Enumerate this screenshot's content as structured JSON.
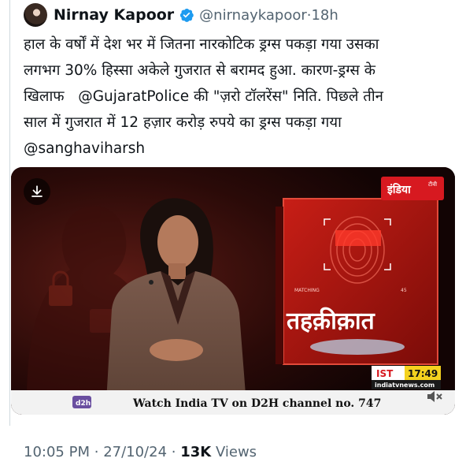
{
  "author": {
    "name": "Nirnay Kapoor",
    "handle": "@nirnaykapoor",
    "time": "18h",
    "separator": "·"
  },
  "tweet": {
    "line1": "हाल के वर्षों में देश भर में जितना नारकोटिक ड्रग्स पकड़ा गया उसका",
    "line2": "लगभग 30% हिस्सा अकेले गुजरात से बरामद हुआ. कारण-ड्रग्स के",
    "line3_pre": "खिलाफ",
    "line3_mention": "@GujaratPolice",
    "line3_post": "की \"ज़रो टॉलरेंस\" निति. पिछले तीन",
    "line4": "साल में गुजरात में 12 हज़ार करोड़ रुपये का ड्रग्स पकड़ा गया",
    "line5_mention": "@sanghaviharsh"
  },
  "media": {
    "channel_logo": "इंडिया",
    "channel_logo_suffix": "टीवी",
    "show_title": "तहक़ीक़ात",
    "panel_label_left": "MATCHING",
    "panel_label_right": "45",
    "clock_zone": "IST",
    "clock_time": "17:49",
    "website": "indiatvnews.com",
    "ticker_badge": "d2h",
    "ticker_text": "Watch India TV on D2H channel no. 747",
    "download_icon": "download-icon",
    "mute_icon": "speaker-mute-icon"
  },
  "footer": {
    "time": "10:05 PM",
    "date": "27/10/24",
    "views_count": "13K",
    "views_label": "Views",
    "separator": "·"
  },
  "colors": {
    "verified_blue": "#1d9bf0",
    "text_primary": "#0f1419",
    "text_secondary": "#536471",
    "ticker_bg": "#f2f2f2",
    "clock_yellow": "#f4d21f",
    "logo_red": "#d71920"
  }
}
